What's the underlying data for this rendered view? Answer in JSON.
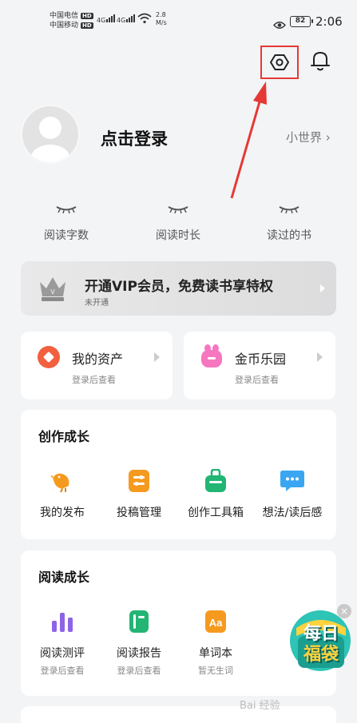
{
  "status_bar": {
    "carrier_1": "中国电信",
    "carrier_2": "中国移动",
    "hd": "HD",
    "net_1": "4G",
    "net_2": "4G",
    "speed_value": "2.8",
    "speed_unit": "M/s",
    "battery": "82",
    "time": "2:06"
  },
  "profile": {
    "login_label": "点击登录",
    "world_label": "小世界 ›"
  },
  "stats": [
    {
      "label": "阅读字数"
    },
    {
      "label": "阅读时长"
    },
    {
      "label": "读过的书"
    }
  ],
  "vip": {
    "title": "开通VIP会员，免费读书享特权",
    "subtitle": "未开通"
  },
  "assets": {
    "my_assets": {
      "title": "我的资产",
      "subtitle": "登录后查看"
    },
    "coin_park": {
      "title": "金币乐园",
      "subtitle": "登录后查看"
    }
  },
  "creation": {
    "title": "创作成长",
    "items": [
      {
        "label": "我的发布",
        "icon": "bird-icon"
      },
      {
        "label": "投稿管理",
        "icon": "manage-icon"
      },
      {
        "label": "创作工具箱",
        "icon": "toolbox-icon"
      },
      {
        "label": "想法/读后感",
        "icon": "chat-icon"
      }
    ]
  },
  "reading": {
    "title": "阅读成长",
    "items": [
      {
        "label": "阅读测评",
        "subtitle": "登录后查看",
        "icon": "chart-icon"
      },
      {
        "label": "阅读报告",
        "subtitle": "登录后查看",
        "icon": "notebook-icon"
      },
      {
        "label": "单词本",
        "subtitle": "暂无生词",
        "icon": "word-book-icon"
      }
    ]
  },
  "promo": {
    "line1": "每日",
    "line2": "福袋",
    "close": "×"
  },
  "watermark": "Bai 经验",
  "colors": {
    "highlight_red": "#e53935",
    "asset_orange": "#f2603f",
    "coin_pink": "#f776c0",
    "creation_orange": "#f59a1f",
    "creation_green": "#22b573",
    "creation_blue": "#3aa6f2",
    "reading_purple": "#8e63e6"
  }
}
